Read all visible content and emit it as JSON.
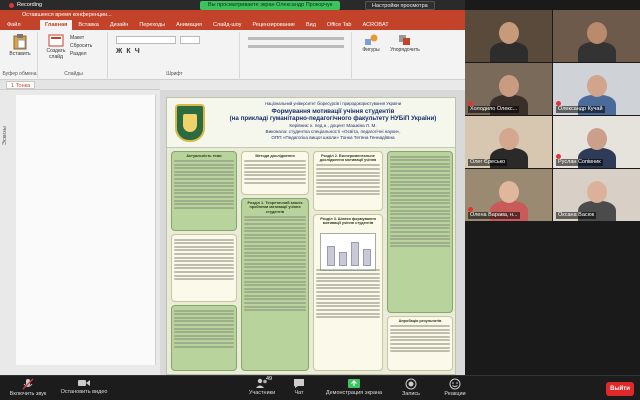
{
  "zoom": {
    "recording_label": "Recording",
    "share_banner": "Вы просматриваете экран Олександр Прокорчук",
    "share_options": "Настройки просмотра"
  },
  "ppt": {
    "autosave": "Оставшееся время конференции...",
    "file_tab": "Файл",
    "tabs": [
      "Главная",
      "Вставка",
      "Дизайн",
      "Переходы",
      "Анимация",
      "Слайд-шоу",
      "Рецензирование",
      "Вид",
      "Office Tab",
      "ACROBAT"
    ],
    "ribbon": {
      "paste": "Вставить",
      "create_slide": "Создать слайд",
      "layout": "Макет",
      "reset": "Сбросить",
      "section": "Раздел",
      "buffer_group": "Буфер обмена",
      "slides_group": "Слайды",
      "font_group": "Шрифт",
      "shapes": "Фигуры",
      "arrange": "Упорядочить"
    },
    "slide_tab": "1 Тонка",
    "side_label": "Эскизы"
  },
  "poster": {
    "header_line1": "Національний університет біоресурсів і природокористування України",
    "title_line1": "Формування мотивації учіння студентів",
    "title_line2": "(на прикладі гуманітарно-педагогічного факультету НУБіП України)",
    "supervisor": "Керівник: к. пед.н., доцент Машкіна Л. М.",
    "author_line": "Виконала: студентка спеціальності «Освіта, педагогічні науки»,",
    "program_line": "ОПП «Педагогіка вищої школи» Тонка Тетяна Геннадіївна",
    "col1": {
      "box1_title": "Актуальність теми",
      "box2_title": "",
      "box3_title": ""
    },
    "col2": {
      "box1_title": "Методи дослідження",
      "box2_title": "Розділ 1. Теоретичний аналіз проблеми мотивації учіння студентів"
    },
    "col3": {
      "box1_title": "Розділ 2. Експериментальне дослідження мотивації учіння",
      "box2_title": "Розділ 3. Шляхи формування мотивації учіння студентів"
    },
    "col4": {
      "box2_title": "Апробація результатів"
    }
  },
  "gallery": {
    "participants": [
      {
        "name": "",
        "muted": false
      },
      {
        "name": "",
        "muted": false
      },
      {
        "name": "Холодило Олекс...",
        "muted": true
      },
      {
        "name": "Олександр Кучай",
        "muted": true
      },
      {
        "name": "Олег Єресько",
        "muted": false
      },
      {
        "name": "Руслан Сопівник",
        "muted": true
      },
      {
        "name": "Олена Варава, н...",
        "muted": true
      },
      {
        "name": "Оксана Васюк",
        "muted": false
      }
    ]
  },
  "toolbar": {
    "mute": "Включить звук",
    "video": "Остановить видео",
    "participants": "Участники",
    "participants_count": "49",
    "chat": "Чат",
    "share": "Демонстрация экрана",
    "record": "Запись",
    "reactions": "Реакции",
    "leave": "Выйти"
  },
  "colors": {
    "ppt_accent": "#c2432a",
    "share_green": "#3cc35f",
    "leave_red": "#e02828",
    "poster_green": "#b9d39d"
  }
}
